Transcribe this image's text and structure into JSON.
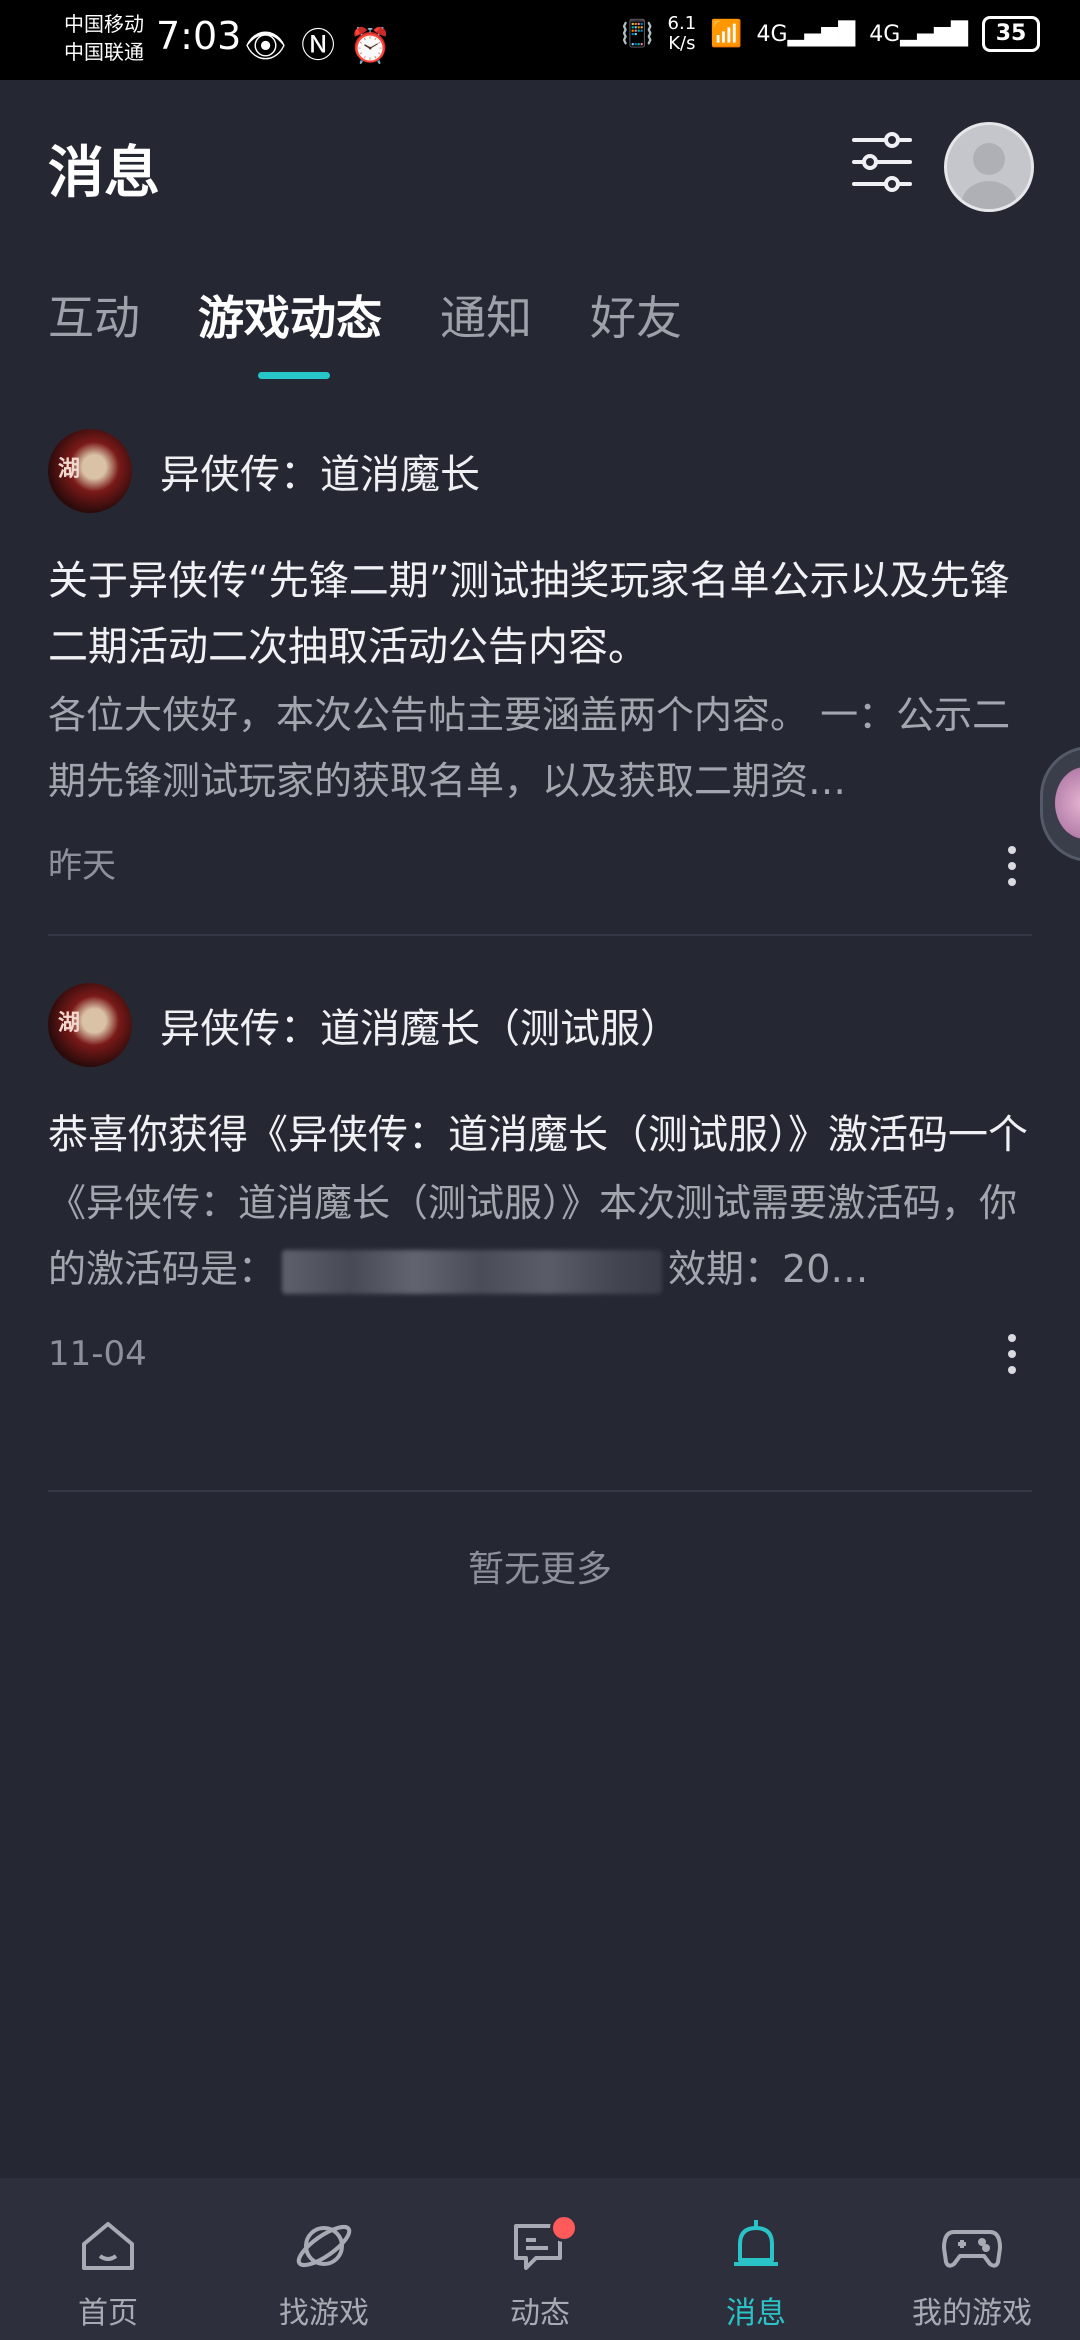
{
  "status_bar": {
    "carrier_1": "中国移动",
    "carrier_2": "中国联通",
    "time": "7:03",
    "net_speed_value": "6.1",
    "net_speed_unit": "K/s",
    "battery": "35",
    "icons": [
      "eye-icon",
      "nfc-icon",
      "alarm-icon",
      "vibrate-icon",
      "wifi-icon",
      "signal-4g-icon",
      "signal-4g-icon"
    ]
  },
  "header": {
    "title": "消息",
    "filter_icon": "sliders-icon",
    "avatar_icon": "user-avatar"
  },
  "tabs": [
    {
      "label": "互动",
      "active": false
    },
    {
      "label": "游戏动态",
      "active": true
    },
    {
      "label": "通知",
      "active": false
    },
    {
      "label": "好友",
      "active": false
    }
  ],
  "messages": [
    {
      "game_name": "异侠传：道消魔长",
      "title": "关于异侠传“先锋二期”测试抽奖玩家名单公示以及先锋二期活动二次抽取活动公告内容。",
      "body": "各位大侠好，本次公告帖主要涵盖两个内容。 一：公示二期先锋测试玩家的获取名单，以及获取二期资…",
      "time": "昨天"
    },
    {
      "game_name": "异侠传：道消魔长（测试服）",
      "title": "恭喜你获得《异侠传：道消魔长（测试服）》激活码一个",
      "body_before": "《异侠传：道消魔长（测试服）》本次测试需要激活码，你的激活码是：",
      "body_after": "效期：20…",
      "time": "11-04"
    }
  ],
  "footer_text": "暂无更多",
  "bottom_nav": [
    {
      "label": "首页",
      "icon": "home-icon",
      "active": false
    },
    {
      "label": "找游戏",
      "icon": "planet-icon",
      "active": false
    },
    {
      "label": "动态",
      "icon": "chat-icon",
      "active": false,
      "badge": true
    },
    {
      "label": "消息",
      "icon": "bell-icon",
      "active": true
    },
    {
      "label": "我的游戏",
      "icon": "gamepad-icon",
      "active": false
    }
  ],
  "colors": {
    "background": "#252833",
    "accent": "#2ac4c8",
    "badge": "#ff5a5a"
  }
}
